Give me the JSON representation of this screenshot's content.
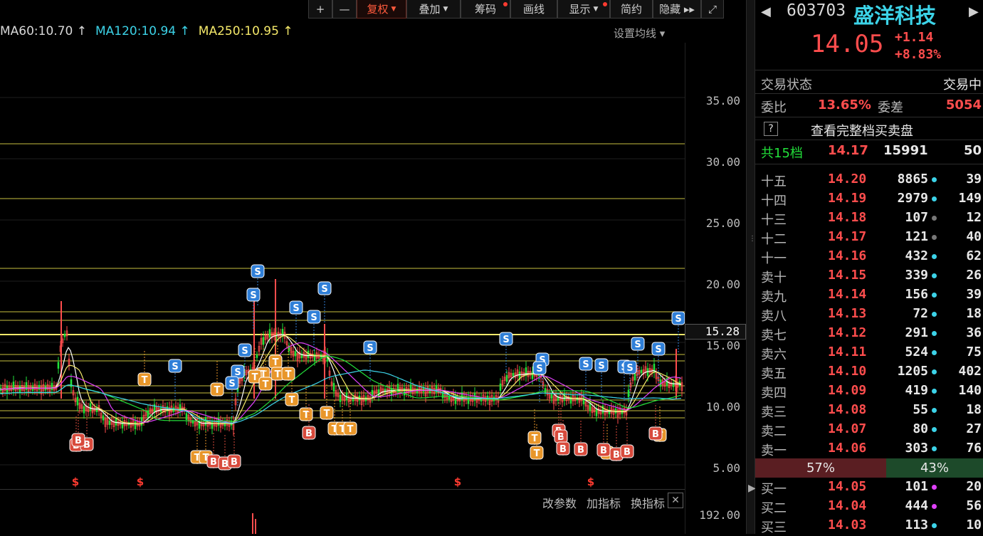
{
  "toolbar": {
    "items": [
      {
        "label": "+",
        "selected": false,
        "dot": false,
        "caret": false
      },
      {
        "label": "—",
        "selected": false,
        "dot": false,
        "caret": false
      },
      {
        "label": "复权",
        "selected": true,
        "dot": false,
        "caret": true
      },
      {
        "label": "叠加",
        "selected": false,
        "dot": false,
        "caret": true
      },
      {
        "label": "筹码",
        "selected": false,
        "dot": true,
        "caret": false
      },
      {
        "label": "画线",
        "selected": false,
        "dot": false,
        "caret": false
      },
      {
        "label": "显示",
        "selected": false,
        "dot": true,
        "caret": true
      },
      {
        "label": "简约",
        "selected": false,
        "dot": false,
        "caret": false
      },
      {
        "label": "隐藏 ▸▸",
        "selected": false,
        "dot": false,
        "caret": false
      },
      {
        "label": "⤢",
        "selected": false,
        "dot": false,
        "caret": false
      }
    ]
  },
  "ma": {
    "ma60": "MA60:10.70 ↑",
    "ma120": "MA120:10.94 ↑",
    "ma250": "MA250:10.95 ↑",
    "setting": "设置均线 ▾"
  },
  "yaxis": {
    "labels": [
      "35.00",
      "30.00",
      "25.00",
      "20.00",
      "15.00",
      "10.00",
      "5.00"
    ],
    "sub_label": "192.00",
    "price_tag": "15.28"
  },
  "subbar": {
    "btn1": "改参数",
    "btn2": "加指标",
    "btn3": "换指标",
    "close": "✕"
  },
  "stock": {
    "code": "603703",
    "name": "盛洋科技",
    "price": "14.05",
    "change": "+1.14",
    "change_pct": "+8.83%"
  },
  "status": {
    "label": "交易状态",
    "value": "交易中"
  },
  "ratio": {
    "wb_label": "委比",
    "wb_value": "13.65%",
    "wc_label": "委差",
    "wc_value": "5054"
  },
  "full_book": {
    "icon": "?",
    "text": "查看完整档买卖盘"
  },
  "summary": {
    "label": "共15档",
    "price": "14.17",
    "vol": "15991",
    "n": "50"
  },
  "asks": [
    {
      "label": "十五",
      "price": "14.20",
      "vol": "8865",
      "dot": "#3cd3e8",
      "n": "39"
    },
    {
      "label": "十四",
      "price": "14.19",
      "vol": "2979",
      "dot": "#3cd3e8",
      "n": "149"
    },
    {
      "label": "十三",
      "price": "14.18",
      "vol": "107",
      "dot": "#777777",
      "n": "12"
    },
    {
      "label": "十二",
      "price": "14.17",
      "vol": "121",
      "dot": "#777777",
      "n": "40"
    },
    {
      "label": "十一",
      "price": "14.16",
      "vol": "432",
      "dot": "#3cd3e8",
      "n": "62"
    },
    {
      "label": "卖十",
      "price": "14.15",
      "vol": "339",
      "dot": "#3cd3e8",
      "n": "26"
    },
    {
      "label": "卖九",
      "price": "14.14",
      "vol": "156",
      "dot": "#3cd3e8",
      "n": "39"
    },
    {
      "label": "卖八",
      "price": "14.13",
      "vol": "72",
      "dot": "#3cd3e8",
      "n": "18"
    },
    {
      "label": "卖七",
      "price": "14.12",
      "vol": "291",
      "dot": "#3cd3e8",
      "n": "36"
    },
    {
      "label": "卖六",
      "price": "14.11",
      "vol": "524",
      "dot": "#3cd3e8",
      "n": "75"
    },
    {
      "label": "卖五",
      "price": "14.10",
      "vol": "1205",
      "dot": "#3cd3e8",
      "n": "402"
    },
    {
      "label": "卖四",
      "price": "14.09",
      "vol": "419",
      "dot": "#3cd3e8",
      "n": "140"
    },
    {
      "label": "卖三",
      "price": "14.08",
      "vol": "55",
      "dot": "#3cd3e8",
      "n": "18"
    },
    {
      "label": "卖二",
      "price": "14.07",
      "vol": "80",
      "dot": "#3cd3e8",
      "n": "27"
    },
    {
      "label": "卖一",
      "price": "14.06",
      "vol": "303",
      "dot": "#3cd3e8",
      "n": "76"
    }
  ],
  "buysell_ratio": {
    "buy": "57%",
    "sell": "43%"
  },
  "bids": [
    {
      "label": "买一",
      "price": "14.05",
      "vol": "101",
      "dot": "#e040fb",
      "n": "20"
    },
    {
      "label": "买二",
      "price": "14.04",
      "vol": "444",
      "dot": "#e040fb",
      "n": "56"
    },
    {
      "label": "买三",
      "price": "14.03",
      "vol": "113",
      "dot": "#3cd3e8",
      "n": "10"
    }
  ],
  "markers": {
    "sell": "S",
    "buy": "B",
    "t": "T",
    "dollar": "$"
  },
  "colors": {
    "up": "#ff4d4d",
    "down": "#22e03a",
    "ma_white": "#d8d8d8",
    "ma_cyan": "#3cd3e8",
    "ma_yellow": "#f5e96a",
    "marker_s": "#2f7fd8",
    "marker_b": "#d84a3c",
    "marker_t": "#e8962a"
  }
}
